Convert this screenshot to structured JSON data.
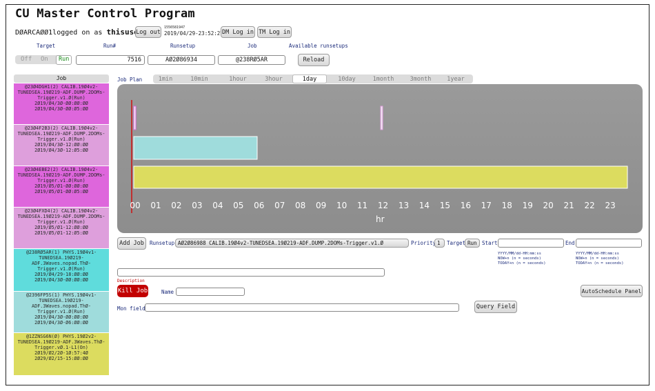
{
  "header": {
    "title": "CU Master Control Program",
    "user_prefix": "DØARCAØØ1logged on as ",
    "username": "thisuser",
    "logout_label": "Log out",
    "timestamp_epoch": "1556581947",
    "timestamp_text": "2019/04/29-23:52:27",
    "dm_login_label": "DM Log in",
    "tm_login_label": "TM Log in"
  },
  "controls": {
    "target_label": "Target",
    "run_num_label": "Run#",
    "runsetup_label": "Runsetup",
    "job_label": "Job",
    "available_runsetups_label": "Available runsetups",
    "toggle": {
      "off": "Off",
      "on": "On",
      "run": "Run",
      "active": "Run"
    },
    "run_number": "7516",
    "runsetup_value": "AØ2Ø86934",
    "job_value": "@238RØ5AR",
    "reload_label": "Reload"
  },
  "job_list": {
    "header": "Job",
    "items": [
      {
        "text": "@23Ø4DGH1(2) CALIB.19Ø4v2-TUNEDSEA.19Ø219-ADF.DUMP.2DOMs-Trigger.v1.Ø(Run)\n2Ø19/Ø4/3Ø-ØØ:ØØ:ØØ\n2Ø19/Ø4/3Ø-ØØ:Ø5:ØØ",
        "color": "#de66dc"
      },
      {
        "text": "@23Ø4F2B3(2) CALIB.19Ø4v2-TUNEDSEA.19Ø219-ADF.DUMP.2DOMs-Trigger.v1.Ø(Run)\n2Ø19/Ø4/3Ø-12:ØØ:ØØ\n2Ø19/Ø4/3Ø-12:Ø5:ØØ",
        "color": "#de9fdc"
      },
      {
        "text": "@23Ø4EBE2(2) CALIB.19Ø4v2-TUNEDSEA.19Ø219-ADF.DUMP.2DOMs-Trigger.v1.Ø(Run)\n2Ø19/Ø5/Ø1-ØØ:ØØ:ØØ\n2Ø19/Ø5/Ø1-ØØ:Ø5:ØØ",
        "color": "#de66dc"
      },
      {
        "text": "@23Ø4FXD4(2) CALIB.19Ø4v2-TUNEDSEA.19Ø219-ADF.DUMP.2DOMs-Trigger.v1.Ø(Run)\n2Ø19/Ø5/Ø1-12:ØØ:ØØ\n2Ø19/Ø5/Ø1-12:Ø5:ØØ",
        "color": "#de9fdc"
      },
      {
        "text": "@238RØ5AR(1) PHYS.19Ø4v1-TUNEDSEA.19Ø219-ADF.3Waves.nopad.ThØ-Trigger.v1.Ø(Run)\n2Ø19/Ø4/29-18:ØØ:ØØ\n2Ø19/Ø4/3Ø-ØØ:ØØ:ØØ",
        "color": "#5fdcdc"
      },
      {
        "text": "@2396FP5S(1) PHYS.19Ø4v1-TUNEDSEA.19Ø219-ADF.3Waves.nopad.ThØ-Trigger.v1.Ø(Run)\n2Ø19/Ø4/3Ø-ØØ:ØØ:ØØ\n2Ø19/Ø4/3Ø-Ø6:ØØ:ØØ",
        "color": "#9fdcdc"
      },
      {
        "text": "@1ZZNSG6N(Ø) PHYS.19Ø2v2-TUNEDSEA.19Ø219-ADF.3Waves.ThØ-Trigger.vØ.1-L1(On)\n2Ø19/Ø2/2Ø-1Ø:57:4Ø\n2Ø29/Ø2/15-15:ØØ:ØØ",
        "color": "#dcdc5f"
      }
    ]
  },
  "job_plan": {
    "label": "Job Plan",
    "ranges": [
      "1min",
      "10min",
      "1hour",
      "3hour",
      "1day",
      "10day",
      "1month",
      "3month",
      "1year"
    ],
    "selected": "1day"
  },
  "chart_data": {
    "type": "bar",
    "orientation": "horizontal-timeline",
    "xlabel": "hr",
    "xlim": [
      0,
      24
    ],
    "ticks": [
      "00",
      "01",
      "02",
      "03",
      "04",
      "05",
      "06",
      "07",
      "08",
      "09",
      "10",
      "11",
      "12",
      "13",
      "14",
      "15",
      "16",
      "17",
      "18",
      "19",
      "20",
      "21",
      "22",
      "23"
    ],
    "now_marker_hr": 0,
    "rows": [
      {
        "bars": [
          {
            "start": 0.0,
            "end": 0.083,
            "color": "#de66dc"
          },
          {
            "start": 12.0,
            "end": 12.083,
            "color": "#de9fdc"
          }
        ]
      },
      {
        "bars": [
          {
            "start": 0.0,
            "end": 6.0,
            "color": "#9fdcdc"
          }
        ]
      },
      {
        "bars": [
          {
            "start": 0.0,
            "end": 24.0,
            "color": "#dcdc5f"
          }
        ]
      }
    ],
    "background": "#999999"
  },
  "form": {
    "add_job_label": "Add Job",
    "runsetup_label": "Runsetup",
    "runsetup_value": "AØ2Ø86988 CALIB.19Ø4v2-TUNEDSEA.19Ø219-ADF.DUMP.2DOMs-Trigger.v1.Ø",
    "priority_label": "Priority",
    "priority_value": "1",
    "target_label": "Target",
    "target_value": "Run",
    "start_label": "Start",
    "end_label": "End",
    "start_hint": "YYYY/MM/dd-HH:mm:ss\nNOW+n (n = seconds)\nTODAY+n (n = seconds)",
    "end_hint": "YYYY/MM/dd-HH:mm:ss\nNOW+n (n = seconds)\nTODAY+n (n = seconds)",
    "description_label": "Description",
    "kill_job_label": "Kill Job",
    "name_label": "Name",
    "autoschedule_label": "AutoSchedule Panel",
    "mon_field_label": "Mon field",
    "query_field_label": "Query Field"
  },
  "colors": {
    "kill": "#c20000",
    "label_blue": "#1a2a7a",
    "now_line": "#d01010"
  }
}
